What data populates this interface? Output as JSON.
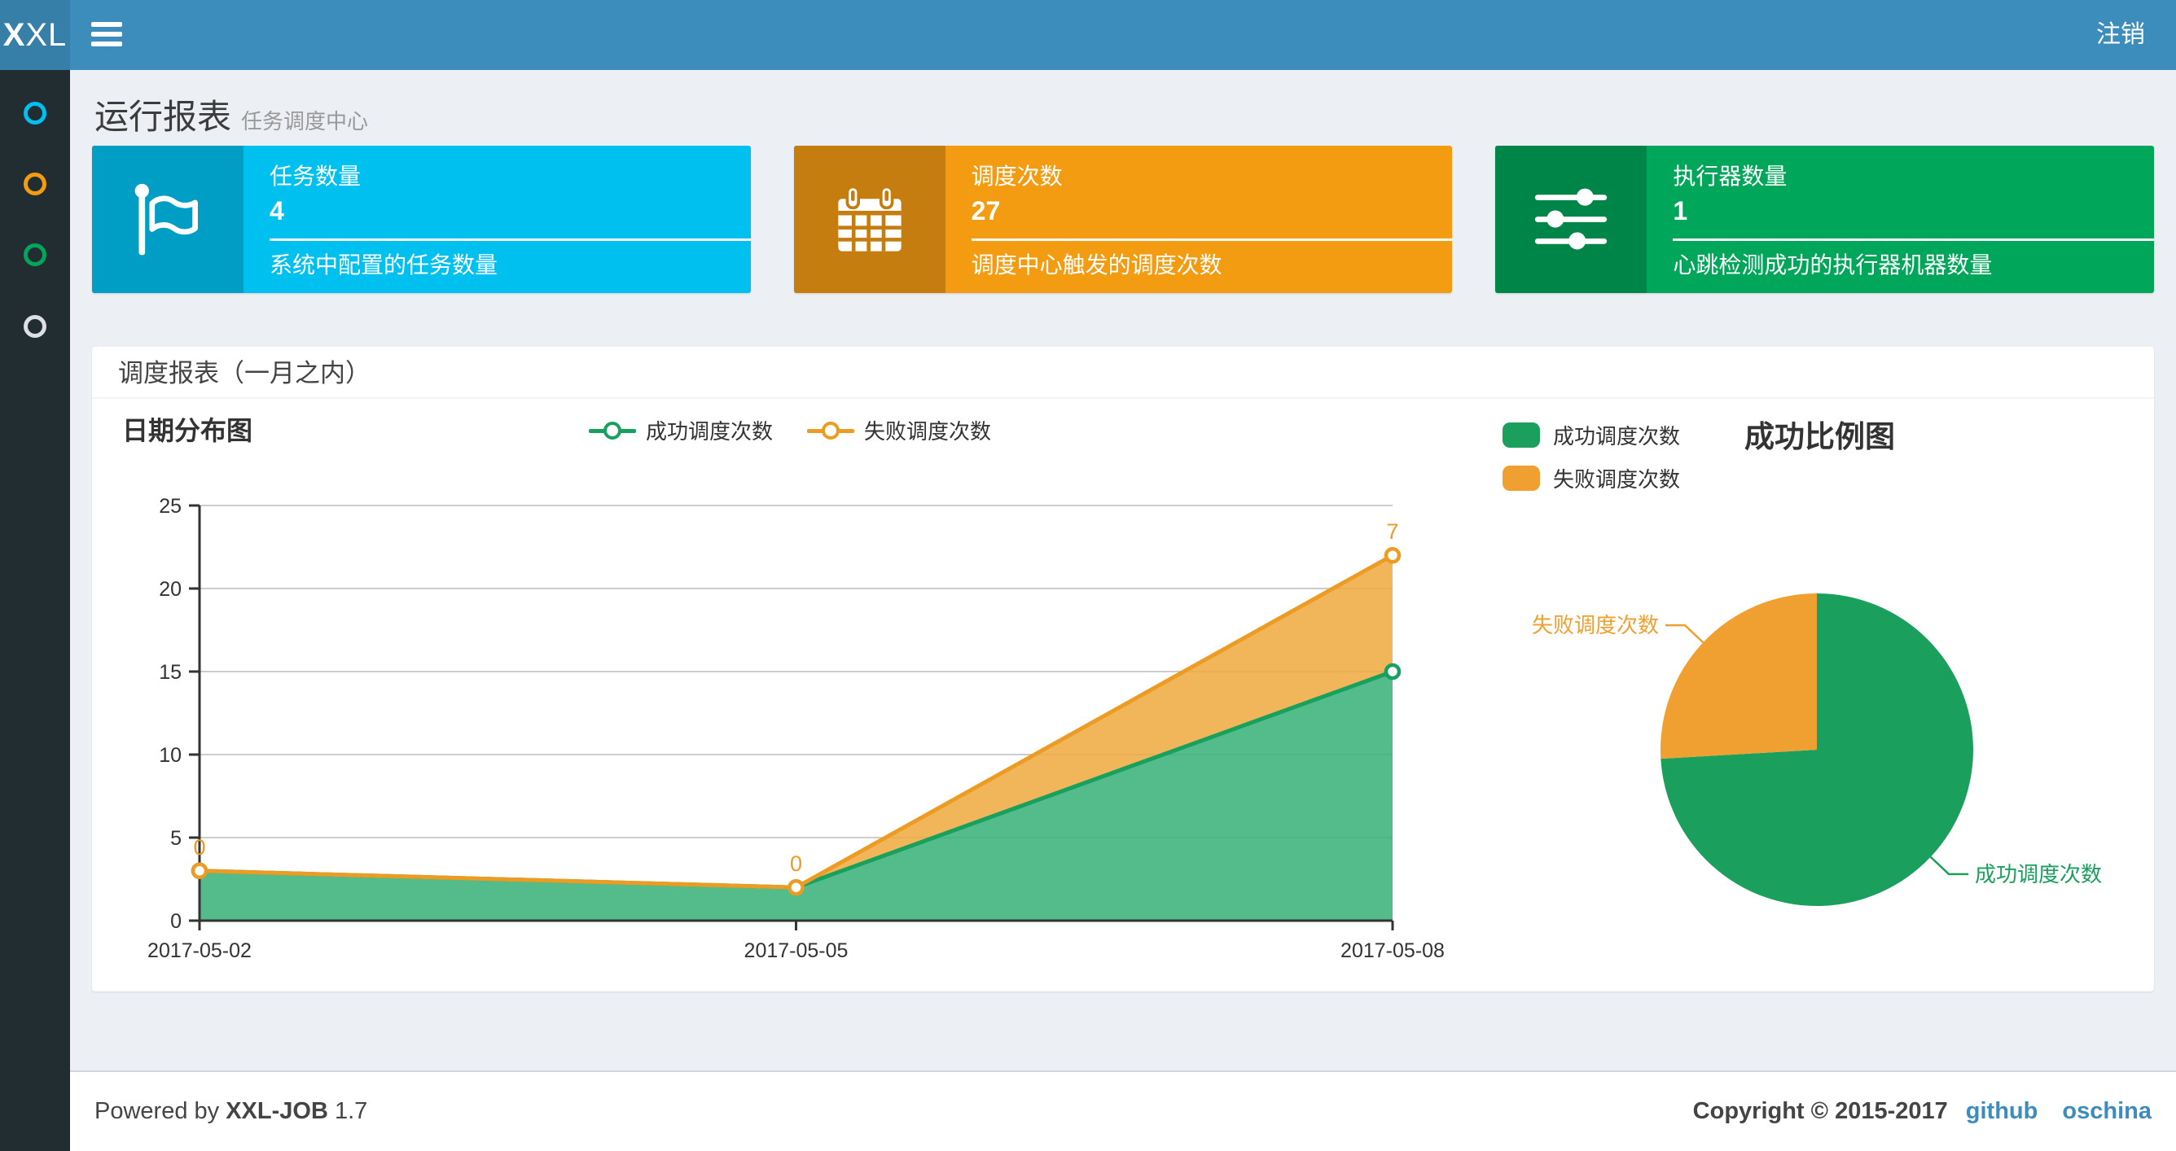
{
  "colors": {
    "navbar_bg": "#3c8dbc",
    "logo_bg": "#367fa9",
    "sidebar_bg": "#222d32",
    "content_bg": "#ecf0f5",
    "footer_border": "#d2d6de",
    "link": "#3c8dbc"
  },
  "navbar": {
    "logo_bold": "X",
    "logo_rest": "XL",
    "logout": "注销"
  },
  "sidebar": {
    "items": [
      {
        "color": "#00c0ef"
      },
      {
        "color": "#f39c12"
      },
      {
        "color": "#00a65a"
      },
      {
        "color": "#dcdfe4"
      }
    ]
  },
  "header": {
    "title": "运行报表",
    "subtitle": "任务调度中心"
  },
  "info_boxes": [
    {
      "icon": "flag-icon",
      "label": "任务数量",
      "value": "4",
      "desc": "系统中配置的任务数量",
      "bg": "#00c0ef",
      "bg_dark": "#009dc5"
    },
    {
      "icon": "calendar-icon",
      "label": "调度次数",
      "value": "27",
      "desc": "调度中心触发的调度次数",
      "bg": "#f39c12",
      "bg_dark": "#c47d0e"
    },
    {
      "icon": "sliders-icon",
      "label": "执行器数量",
      "value": "1",
      "desc": "心跳检测成功的执行器机器数量",
      "bg": "#00a65a",
      "bg_dark": "#008549"
    }
  ],
  "panel": {
    "title": "调度报表（一月之内）"
  },
  "chart_data": [
    {
      "type": "area",
      "title": "日期分布图",
      "x": [
        "2017-05-02",
        "2017-05-05",
        "2017-05-08"
      ],
      "stacked": true,
      "series": [
        {
          "name": "成功调度次数",
          "values": [
            3,
            2,
            15
          ],
          "color": "#17a05e",
          "fill": "#36b077"
        },
        {
          "name": "失败调度次数",
          "values": [
            0,
            0,
            7
          ],
          "color": "#ed9c23",
          "fill": "#efa93c"
        }
      ],
      "point_labels": {
        "series": "失败调度次数",
        "values": [
          "0",
          "0",
          "7"
        ]
      },
      "ylim": [
        0,
        25
      ],
      "yticks": [
        0,
        5,
        10,
        15,
        20,
        25
      ],
      "grid": true,
      "legend_position": "top-center"
    },
    {
      "type": "pie",
      "title": "成功比例图",
      "slices": [
        {
          "label": "成功调度次数",
          "value": 20,
          "color": "#1aa05c"
        },
        {
          "label": "失败调度次数",
          "value": 7,
          "color": "#f0a030"
        }
      ],
      "legend_position": "top-left"
    }
  ],
  "footer": {
    "powered_by": "Powered by",
    "brand": "XXL-JOB",
    "version": "1.7",
    "copyright": "Copyright © 2015-2017",
    "links": [
      {
        "label": "github"
      },
      {
        "label": "oschina"
      }
    ]
  }
}
